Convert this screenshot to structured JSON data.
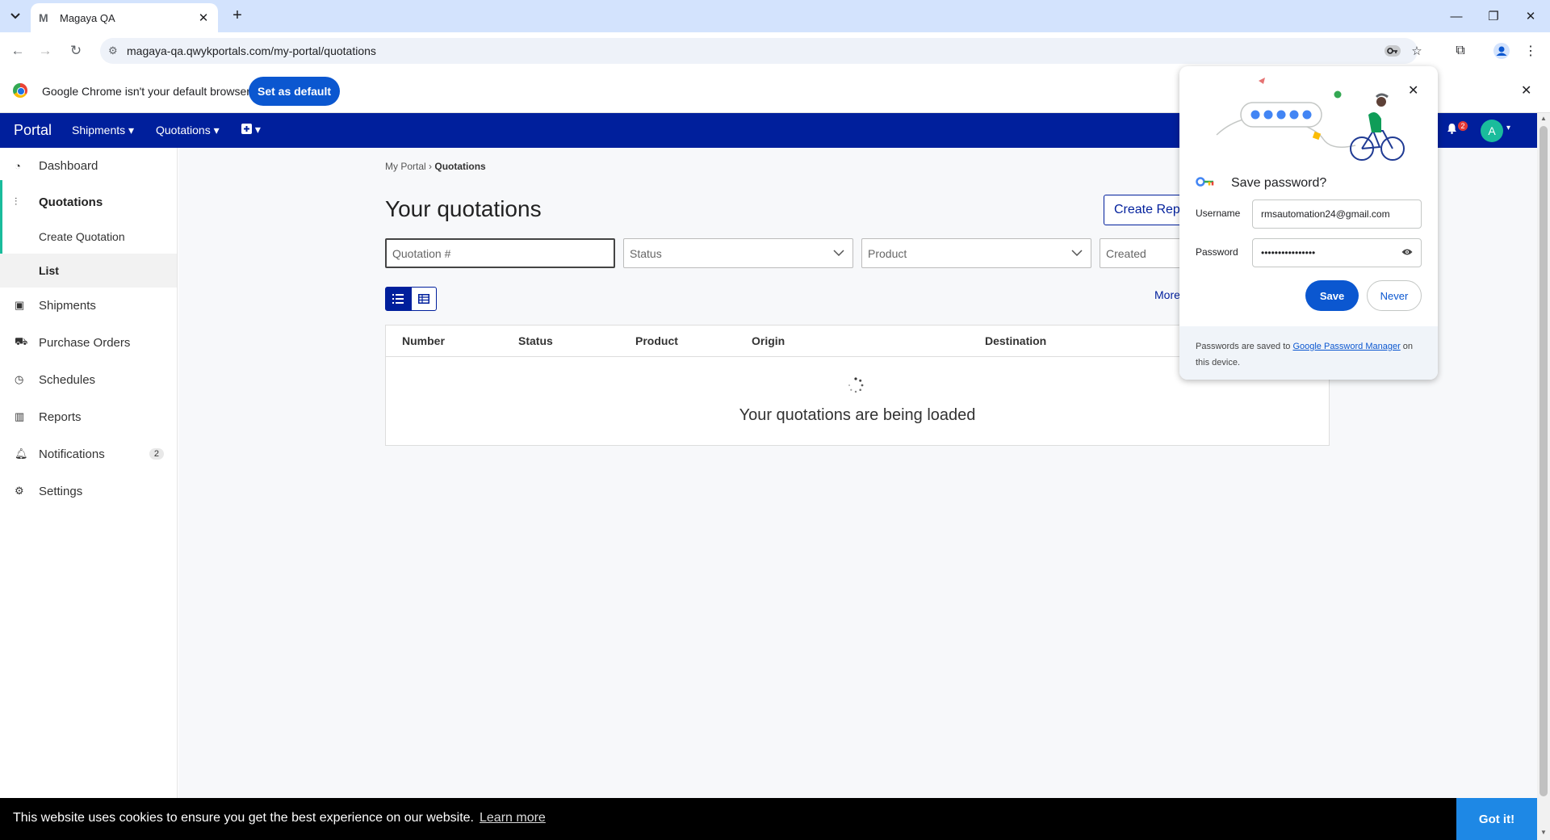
{
  "browser": {
    "tab_title": "Magaya QA",
    "tab_favicon": "M",
    "url": "magaya-qa.qwykportals.com/my-portal/quotations",
    "accent": "#d3e3fd"
  },
  "infobar": {
    "message": "Google Chrome isn't your default browser",
    "set_default_label": "Set as default"
  },
  "appnav": {
    "brand": "Portal",
    "menus": [
      "Shipments",
      "Quotations"
    ],
    "notif_count": "2",
    "avatar_initial": "A",
    "bg_color": "#001f9c"
  },
  "sidebar": {
    "items": [
      {
        "label": "Dashboard",
        "icon": "gauge-icon"
      },
      {
        "label": "Quotations",
        "icon": "quotations-icon"
      },
      {
        "label": "Create Quotation"
      },
      {
        "label": "List"
      },
      {
        "label": "Shipments",
        "icon": "box-icon"
      },
      {
        "label": "Purchase Orders",
        "icon": "cart-icon"
      },
      {
        "label": "Schedules",
        "icon": "clock-icon"
      },
      {
        "label": "Reports",
        "icon": "bar-chart-icon"
      },
      {
        "label": "Notifications",
        "icon": "bell-icon",
        "badge": "2"
      },
      {
        "label": "Settings",
        "icon": "gear-icon"
      }
    ]
  },
  "main": {
    "breadcrumb_root": "My Portal",
    "breadcrumb_sep": "›",
    "breadcrumb_current": "Quotations",
    "title": "Your quotations",
    "create_button": "Create Rep",
    "filters": {
      "quotation_placeholder": "Quotation #",
      "status": "Status",
      "product": "Product",
      "created": "Created"
    },
    "more_label": "More",
    "table_headers": [
      "Number",
      "Status",
      "Product",
      "Origin",
      "Destination"
    ],
    "loading_text": "Your quotations are being loaded"
  },
  "cookie": {
    "message": "This website uses cookies to ensure you get the best experience on our website.",
    "learn_more": "Learn more",
    "got_it": "Got it!"
  },
  "password_popup": {
    "heading": "Save password?",
    "username_label": "Username",
    "username_value": "rmsautomation24@gmail.com",
    "password_label": "Password",
    "password_value": "••••••••••••••••",
    "save_label": "Save",
    "never_label": "Never",
    "footer_text_1": "Passwords are saved to ",
    "footer_link": "Google Password Manager",
    "footer_text_2": " on this device."
  }
}
